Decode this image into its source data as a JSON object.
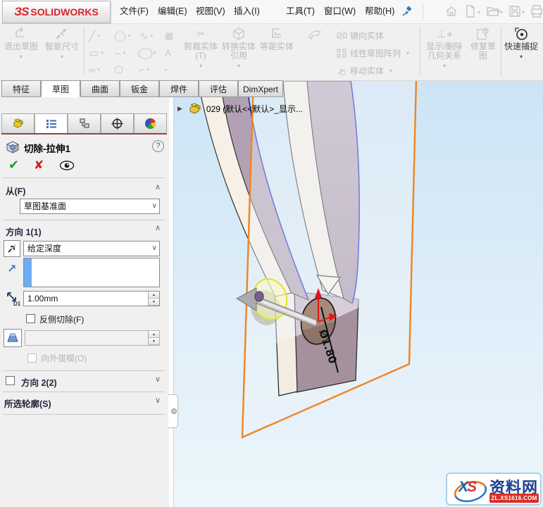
{
  "brand": {
    "ds": "ЗS",
    "name": "SOLIDWORKS"
  },
  "menubar": {
    "items": [
      {
        "label": "文件(F)"
      },
      {
        "label": "编辑(E)"
      },
      {
        "label": "视图(V)"
      },
      {
        "label": "插入(I)"
      },
      {
        "label": "工具(T)"
      },
      {
        "label": "窗口(W)"
      },
      {
        "label": "帮助(H)"
      }
    ]
  },
  "ribbon": {
    "exit_sketch": "退出草图",
    "smart_dimension": "智能尺寸",
    "trim_entities": "剪裁实体(T)",
    "convert_entities": "转换实体引用",
    "offset_entities": "等距实体",
    "offset_on_surface": "曲面上偏移",
    "mirror_entities": "镜向实体",
    "linear_pattern": "线性草图阵列",
    "move_entities": "移动实体",
    "display_relations": "显示/删除几何关系",
    "repair_sketch": "修复草图",
    "quick_snaps": "快速捕捉"
  },
  "command_tabs": {
    "active": "草图",
    "items": [
      {
        "label": "特征"
      },
      {
        "label": "草图"
      },
      {
        "label": "曲面"
      },
      {
        "label": "钣金"
      },
      {
        "label": "焊件"
      },
      {
        "label": "评估"
      },
      {
        "label": "DimXpert"
      }
    ]
  },
  "feature_tree": {
    "root_label": "029  (默认<<默认>_显示..."
  },
  "property_panel": {
    "title": "切除-拉伸1",
    "from": {
      "label": "从(F)",
      "value": "草图基准面"
    },
    "direction1": {
      "label": "方向 1(1)",
      "end_condition": "给定深度",
      "depth_value": "1.00mm",
      "flip_side_label": "反侧切除(F)",
      "draft_outward_label": "向外拔模(O)"
    },
    "direction2": {
      "label": "方向 2(2)"
    },
    "selected_contours": {
      "label": "所选轮廓(S)"
    }
  },
  "viewport": {
    "dimension": "Ø1.80"
  },
  "watermark": {
    "x": "X",
    "s": "S",
    "site": "资料网",
    "url": "ZL.XS1616.COM"
  },
  "colors": {
    "plane_border": "#F08420",
    "selection_fill": "#6BADF0",
    "part_lavender": "#B2A1B4",
    "part_cream": "#F6F0E7",
    "edge_blue": "#2626C8",
    "preview_yellow": "#E8E82A",
    "logo_red": "#D8262C"
  }
}
